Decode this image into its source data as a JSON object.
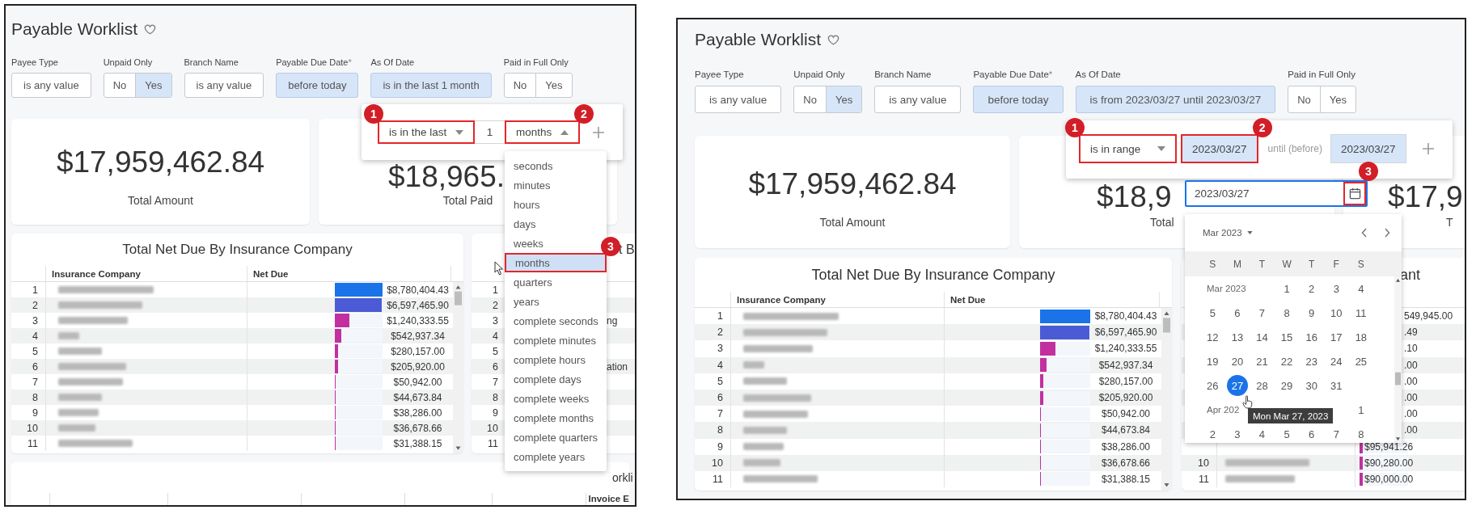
{
  "panels": [
    {
      "title": "Payable Worklist",
      "filters": [
        {
          "kind": "text",
          "label": "Payee Type",
          "value": "is any value",
          "active": false
        },
        {
          "kind": "toggle",
          "label": "Unpaid Only",
          "options": [
            {
              "label": "No",
              "selected": false
            },
            {
              "label": "Yes",
              "selected": true
            }
          ]
        },
        {
          "kind": "text",
          "label": "Branch Name",
          "value": "is any value",
          "active": false
        },
        {
          "kind": "text",
          "label": "Payable Due Date",
          "required_mark": "*",
          "value": "before today",
          "active": true
        },
        {
          "kind": "text",
          "label": "As Of Date",
          "value": "is in the last 1 month",
          "active": true
        },
        {
          "kind": "toggle",
          "label": "Paid in Full Only",
          "options": [
            {
              "label": "No",
              "selected": false
            },
            {
              "label": "Yes",
              "selected": false
            }
          ]
        }
      ],
      "cards": [
        {
          "amount": "$17,959,462.84",
          "label": "Total Amount"
        },
        {
          "amount": "$18,965.",
          "label": "Total Paid"
        }
      ],
      "tables": [
        {
          "kind": "bars",
          "title": "Total Net Due By Insurance Company",
          "columns": [
            "Insurance Company",
            "Net Due"
          ],
          "rows": [
            {
              "index": "1",
              "amount": "$8,780,404.43",
              "level": 1,
              "color": "#1a73e8"
            },
            {
              "index": "2",
              "amount": "$6,597,465.90",
              "level": 0.99,
              "color": "#4b5bd5"
            },
            {
              "index": "3",
              "amount": "$1,240,333.55",
              "level": 0.31,
              "color": "#c2309f"
            },
            {
              "index": "4",
              "amount": "$542,937.34",
              "level": 0.13,
              "color": "#c2309f"
            },
            {
              "index": "5",
              "amount": "$280,157.00",
              "level": 0.07,
              "color": "#c2309f"
            },
            {
              "index": "6",
              "amount": "$205,920.00",
              "level": 0.06,
              "color": "#c2309f"
            },
            {
              "index": "7",
              "amount": "$50,942.00",
              "level": 0.02,
              "color": "#c2309f"
            },
            {
              "index": "8",
              "amount": "$44,673.84",
              "level": 0.02,
              "color": "#c2309f"
            },
            {
              "index": "9",
              "amount": "$38,286.00",
              "level": 0.02,
              "color": "#c2309f"
            },
            {
              "index": "10",
              "amount": "$36,678.66",
              "level": 0.02,
              "color": "#c2309f"
            },
            {
              "index": "11",
              "amount": "$31,388.15",
              "level": 0.02,
              "color": "#c2309f"
            }
          ]
        },
        {
          "kind": "fragments",
          "title": "t B",
          "rows": [
            {
              "index": "1"
            },
            {
              "index": "2"
            },
            {
              "index": "3",
              "text": "ng"
            },
            {
              "index": "4"
            },
            {
              "index": "5"
            },
            {
              "index": "6",
              "text": "ation"
            },
            {
              "index": "7"
            },
            {
              "index": "8"
            },
            {
              "index": "9"
            },
            {
              "index": "10"
            },
            {
              "index": "11"
            }
          ]
        }
      ],
      "bottom_card": {
        "title": "orkli",
        "header": "Invoice E"
      },
      "popover": {
        "controls": [
          {
            "kind": "select",
            "value": "is in the last",
            "open": false,
            "callout": "1"
          },
          {
            "kind": "number",
            "value": "1"
          },
          {
            "kind": "select",
            "value": "months",
            "open": true,
            "callout": "2"
          },
          {
            "kind": "add"
          }
        ]
      },
      "menu": {
        "items": [
          {
            "label": "seconds",
            "selected": false
          },
          {
            "label": "minutes",
            "selected": false
          },
          {
            "label": "hours",
            "selected": false
          },
          {
            "label": "days",
            "selected": false
          },
          {
            "label": "weeks",
            "selected": false
          },
          {
            "label": "months",
            "selected": true,
            "callout": "3"
          },
          {
            "label": "quarters",
            "selected": false
          },
          {
            "label": "years",
            "selected": false
          },
          {
            "label": "complete seconds",
            "selected": false
          },
          {
            "label": "complete minutes",
            "selected": false
          },
          {
            "label": "complete hours",
            "selected": false
          },
          {
            "label": "complete days",
            "selected": false
          },
          {
            "label": "complete weeks",
            "selected": false
          },
          {
            "label": "complete months",
            "selected": false
          },
          {
            "label": "complete quarters",
            "selected": false
          },
          {
            "label": "complete years",
            "selected": false
          }
        ]
      }
    },
    {
      "title": "Payable Worklist",
      "filters": [
        {
          "kind": "text",
          "label": "Payee Type",
          "value": "is any value",
          "active": false
        },
        {
          "kind": "toggle",
          "label": "Unpaid Only",
          "options": [
            {
              "label": "No",
              "selected": false
            },
            {
              "label": "Yes",
              "selected": true
            }
          ]
        },
        {
          "kind": "text",
          "label": "Branch Name",
          "value": "is any value",
          "active": false
        },
        {
          "kind": "text",
          "label": "Payable Due Date",
          "required_mark": "*",
          "value": "before today",
          "active": true
        },
        {
          "kind": "text",
          "label": "As Of Date",
          "value": "is from 2023/03/27 until 2023/03/27",
          "active": true
        },
        {
          "kind": "toggle",
          "label": "Paid in Full Only",
          "options": [
            {
              "label": "No",
              "selected": false
            },
            {
              "label": "Yes",
              "selected": false
            }
          ]
        }
      ],
      "cards": [
        {
          "amount": "$17,959,462.84",
          "label": "Total Amount"
        },
        {
          "amount": "$18,9",
          "label": "Total"
        },
        {
          "amount": "$17,9",
          "label": "T"
        }
      ],
      "tables": [
        {
          "kind": "bars",
          "title": "Total Net Due By Insurance Company",
          "columns": [
            "Insurance Company",
            "Net Due"
          ],
          "rows": [
            {
              "index": "1",
              "amount": "$8,780,404.43",
              "level": 1,
              "color": "#1a73e8"
            },
            {
              "index": "2",
              "amount": "$6,597,465.90",
              "level": 0.99,
              "color": "#4b5bd5"
            },
            {
              "index": "3",
              "amount": "$1,240,333.55",
              "level": 0.31,
              "color": "#c2309f"
            },
            {
              "index": "4",
              "amount": "$542,937.34",
              "level": 0.13,
              "color": "#c2309f"
            },
            {
              "index": "5",
              "amount": "$280,157.00",
              "level": 0.07,
              "color": "#c2309f"
            },
            {
              "index": "6",
              "amount": "$205,920.00",
              "level": 0.06,
              "color": "#c2309f"
            },
            {
              "index": "7",
              "amount": "$50,942.00",
              "level": 0.02,
              "color": "#c2309f"
            },
            {
              "index": "8",
              "amount": "$44,673.84",
              "level": 0.02,
              "color": "#c2309f"
            },
            {
              "index": "9",
              "amount": "$38,286.00",
              "level": 0.02,
              "color": "#c2309f"
            },
            {
              "index": "10",
              "amount": "$36,678.66",
              "level": 0.02,
              "color": "#c2309f"
            },
            {
              "index": "11",
              "amount": "$31,388.15",
              "level": 0.02,
              "color": "#c2309f"
            }
          ]
        },
        {
          "kind": "fragments",
          "title": "ant",
          "rows": [
            {
              "text": "549,945.00"
            },
            {
              "text": ".49"
            },
            {
              "text": ".10"
            },
            {
              "text": ".00"
            },
            {
              "text": ".00"
            },
            {
              "text": ".00"
            },
            {
              "text": ".00"
            },
            {
              "text": ".00"
            },
            {
              "amount": "$95,941.26",
              "level": 0.06,
              "color": "#c2309f"
            },
            {
              "index": "10",
              "amount": "$90,280.00",
              "level": 0.06,
              "color": "#c2309f"
            },
            {
              "index": "11",
              "amount": "$90,000.00",
              "level": 0.06,
              "color": "#c2309f"
            }
          ]
        }
      ],
      "popover": {
        "controls": [
          {
            "kind": "select",
            "value": "is in range",
            "open": false,
            "callout": "1"
          },
          {
            "kind": "date",
            "value": "2023/03/27",
            "active": true,
            "callout": "2"
          },
          {
            "kind": "label",
            "text": "until (before)"
          },
          {
            "kind": "date",
            "value": "2023/03/27",
            "active": true
          },
          {
            "kind": "add"
          }
        ]
      },
      "date_field": {
        "value": "2023/03/27",
        "focused": true,
        "icon_callout": "3"
      },
      "calendar": {
        "header": "Mar 2023",
        "weekdays": [
          "S",
          "M",
          "T",
          "W",
          "T",
          "F",
          "S"
        ],
        "tooltip": "Mon Mar 27, 2023",
        "months": [
          {
            "label": "Mar 2023",
            "weeks": [
              [
                {
                  "day": "1",
                  "selected": false
                },
                {
                  "day": "2",
                  "selected": false
                },
                {
                  "day": "3",
                  "selected": false
                },
                {
                  "day": "4",
                  "selected": false
                }
              ],
              [
                {
                  "day": "5",
                  "selected": false
                },
                {
                  "day": "6",
                  "selected": false
                },
                {
                  "day": "7",
                  "selected": false
                },
                {
                  "day": "8",
                  "selected": false
                },
                {
                  "day": "9",
                  "selected": false
                },
                {
                  "day": "10",
                  "selected": false
                },
                {
                  "day": "11",
                  "selected": false
                }
              ],
              [
                {
                  "day": "12",
                  "selected": false
                },
                {
                  "day": "13",
                  "selected": false
                },
                {
                  "day": "14",
                  "selected": false
                },
                {
                  "day": "15",
                  "selected": false
                },
                {
                  "day": "16",
                  "selected": false
                },
                {
                  "day": "17",
                  "selected": false
                },
                {
                  "day": "18",
                  "selected": false
                }
              ],
              [
                {
                  "day": "19",
                  "selected": false
                },
                {
                  "day": "20",
                  "selected": false
                },
                {
                  "day": "21",
                  "selected": false
                },
                {
                  "day": "22",
                  "selected": false
                },
                {
                  "day": "23",
                  "selected": false
                },
                {
                  "day": "24",
                  "selected": false
                },
                {
                  "day": "25",
                  "selected": false
                }
              ],
              [
                {
                  "day": "26",
                  "selected": false
                },
                {
                  "day": "27",
                  "selected": true
                },
                {
                  "day": "28",
                  "selected": false
                },
                {
                  "day": "29",
                  "selected": false
                },
                {
                  "day": "30",
                  "selected": false
                },
                {
                  "day": "31",
                  "selected": false
                }
              ]
            ]
          },
          {
            "label": "Apr 202",
            "weeks": [
              [
                {
                  "day": "1",
                  "selected": false
                }
              ],
              [
                {
                  "day": "2",
                  "selected": false
                },
                {
                  "day": "3",
                  "selected": false
                },
                {
                  "day": "4",
                  "selected": false
                },
                {
                  "day": "5",
                  "selected": false
                },
                {
                  "day": "6",
                  "selected": false
                },
                {
                  "day": "7",
                  "selected": false
                },
                {
                  "day": "8",
                  "selected": false
                }
              ]
            ]
          }
        ]
      }
    }
  ]
}
